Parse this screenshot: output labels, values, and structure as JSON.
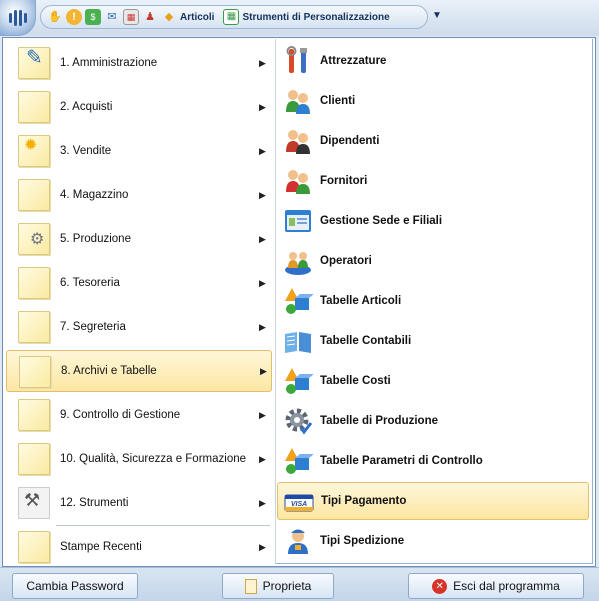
{
  "toolbar": {
    "articoli_label": "Articoli",
    "strumenti_label": "Strumenti di Personalizzazione"
  },
  "left_menu": {
    "items": [
      {
        "label": "1. Amministrazione",
        "icon": "pencil-note-icon"
      },
      {
        "label": "2. Acquisti",
        "icon": "note-icon"
      },
      {
        "label": "3. Vendite",
        "icon": "sun-note-icon"
      },
      {
        "label": "4. Magazzino",
        "icon": "note-icon"
      },
      {
        "label": "5. Produzione",
        "icon": "gear-note-icon"
      },
      {
        "label": "6. Tesoreria",
        "icon": "note-icon"
      },
      {
        "label": "7. Segreteria",
        "icon": "note-icon"
      },
      {
        "label": "8. Archivi e Tabelle",
        "icon": "note-icon"
      },
      {
        "label": "9. Controllo di Gestione",
        "icon": "note-icon"
      },
      {
        "label": "10. Qualità, Sicurezza e Formazione",
        "icon": "note-icon"
      },
      {
        "label": "12. Strumenti",
        "icon": "tools-icon"
      },
      {
        "label": "Stampe Recenti",
        "icon": "note-icon"
      }
    ],
    "active_index": 7
  },
  "submenu": {
    "items": [
      {
        "label": "Attrezzature",
        "icon": "tools-icon"
      },
      {
        "label": "Clienti",
        "icon": "people-icon"
      },
      {
        "label": "Dipendenti",
        "icon": "people-icon"
      },
      {
        "label": "Fornitori",
        "icon": "people-icon"
      },
      {
        "label": "Gestione Sede e Filiali",
        "icon": "id-card-icon"
      },
      {
        "label": "Operatori",
        "icon": "operators-icon"
      },
      {
        "label": "Tabelle Articoli",
        "icon": "shapes-icon"
      },
      {
        "label": "Tabelle Contabili",
        "icon": "book-icon"
      },
      {
        "label": "Tabelle Costi",
        "icon": "shapes-icon"
      },
      {
        "label": "Tabelle di Produzione",
        "icon": "gear-icon"
      },
      {
        "label": "Tabelle Parametri di Controllo",
        "icon": "shapes-icon"
      },
      {
        "label": "Tipi Pagamento",
        "icon": "visa-card-icon"
      },
      {
        "label": "Tipi Spedizione",
        "icon": "courier-icon"
      }
    ],
    "active_index": 11,
    "visa_text": "VISA"
  },
  "bottom": {
    "change_password": "Cambia Password",
    "properties": "Proprieta",
    "exit": "Esci dal programma"
  },
  "colors": {
    "highlight": "#fde7a5",
    "highlight_border": "#e2c06b",
    "frame": "#6f8fb7"
  }
}
